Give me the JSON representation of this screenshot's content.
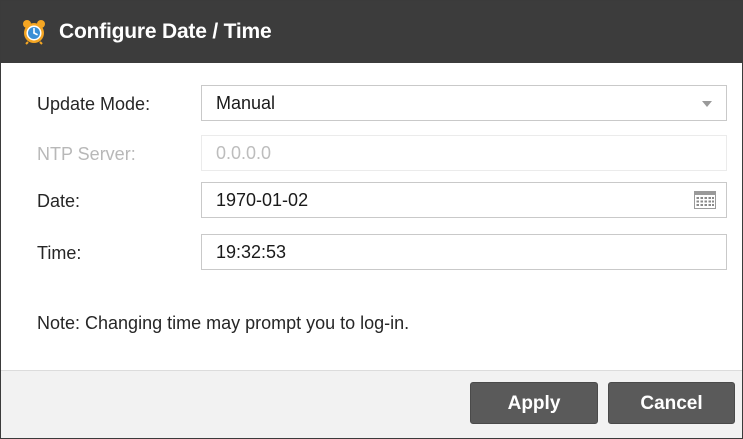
{
  "dialog": {
    "title": "Configure Date / Time",
    "icon": "alarm-clock-icon"
  },
  "form": {
    "update_mode": {
      "label": "Update Mode:",
      "value": "Manual"
    },
    "ntp_server": {
      "label": "NTP Server:",
      "value": "0.0.0.0",
      "disabled": true
    },
    "date": {
      "label": "Date:",
      "value": "1970-01-02",
      "icon": "calendar-icon"
    },
    "time": {
      "label": "Time:",
      "value": "19:32:53"
    }
  },
  "note": "Note: Changing time may prompt you to log-in.",
  "buttons": {
    "apply": "Apply",
    "cancel": "Cancel"
  },
  "colors": {
    "titlebar": "#3c3c3c",
    "button": "#5a5a5a",
    "footer": "#f2f2f2",
    "icon_blue": "#3a8fd6",
    "icon_orange": "#f5a623"
  }
}
